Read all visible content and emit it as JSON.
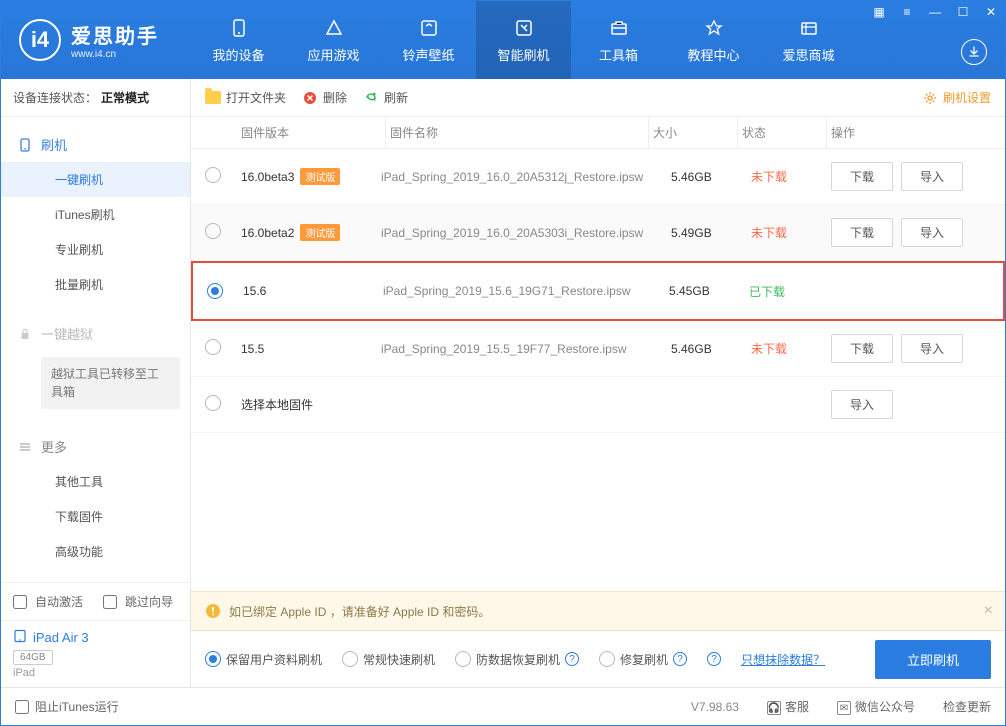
{
  "header": {
    "logo_title": "爱思助手",
    "logo_sub": "www.i4.cn",
    "nav": [
      {
        "label": "我的设备"
      },
      {
        "label": "应用游戏"
      },
      {
        "label": "铃声壁纸"
      },
      {
        "label": "智能刷机"
      },
      {
        "label": "工具箱"
      },
      {
        "label": "教程中心"
      },
      {
        "label": "爱思商城"
      }
    ]
  },
  "sidebar": {
    "conn_label": "设备连接状态：",
    "conn_status": "正常模式",
    "flash_head": "刷机",
    "items": [
      {
        "label": "一键刷机"
      },
      {
        "label": "iTunes刷机"
      },
      {
        "label": "专业刷机"
      },
      {
        "label": "批量刷机"
      }
    ],
    "jailbreak_head": "一键越狱",
    "jailbreak_note": "越狱工具已转移至工具箱",
    "more_head": "更多",
    "more_items": [
      {
        "label": "其他工具"
      },
      {
        "label": "下载固件"
      },
      {
        "label": "高级功能"
      }
    ],
    "auto_activate": "自动激活",
    "skip_guide": "跳过向导",
    "device_name": "iPad Air 3",
    "device_storage": "64GB",
    "device_type": "iPad"
  },
  "toolbar": {
    "open_folder": "打开文件夹",
    "delete": "删除",
    "refresh": "刷新",
    "settings": "刷机设置"
  },
  "table": {
    "cols": {
      "version": "固件版本",
      "name": "固件名称",
      "size": "大小",
      "status": "状态",
      "actions": "操作"
    },
    "download_btn": "下载",
    "import_btn": "导入",
    "rows": [
      {
        "version": "16.0beta3",
        "beta": "测试版",
        "name": "iPad_Spring_2019_16.0_20A5312j_Restore.ipsw",
        "size": "5.46GB",
        "status": "未下载",
        "status_class": "status-not",
        "selected": false,
        "showBtns": true
      },
      {
        "version": "16.0beta2",
        "beta": "测试版",
        "name": "iPad_Spring_2019_16.0_20A5303i_Restore.ipsw",
        "size": "5.49GB",
        "status": "未下载",
        "status_class": "status-not",
        "selected": false,
        "showBtns": true
      },
      {
        "version": "15.6",
        "beta": "",
        "name": "iPad_Spring_2019_15.6_19G71_Restore.ipsw",
        "size": "5.45GB",
        "status": "已下载",
        "status_class": "status-done",
        "selected": true,
        "showBtns": false
      },
      {
        "version": "15.5",
        "beta": "",
        "name": "iPad_Spring_2019_15.5_19F77_Restore.ipsw",
        "size": "5.46GB",
        "status": "未下载",
        "status_class": "status-not",
        "selected": false,
        "showBtns": true
      }
    ],
    "local_row": "选择本地固件"
  },
  "notice": "如已绑定 Apple ID ，请准备好 Apple ID 和密码。",
  "options": {
    "keep_data": "保留用户资料刷机",
    "normal_fast": "常规快速刷机",
    "anti_loss": "防数据恢复刷机",
    "repair": "修复刷机",
    "erase_link": "只想抹除数据？",
    "start": "立即刷机"
  },
  "footer": {
    "block_itunes": "阻止iTunes运行",
    "version": "V7.98.63",
    "service": "客服",
    "wechat": "微信公众号",
    "update": "检查更新"
  }
}
